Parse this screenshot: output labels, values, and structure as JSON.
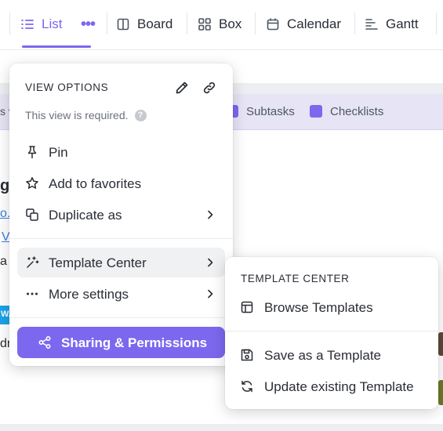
{
  "tabs": [
    {
      "label": "List",
      "icon": "list-icon",
      "active": true
    },
    {
      "label": "Board",
      "icon": "board-icon"
    },
    {
      "label": "Box",
      "icon": "box-grid-icon"
    },
    {
      "label": "Calendar",
      "icon": "calendar-icon"
    },
    {
      "label": "Gantt",
      "icon": "gantt-icon"
    }
  ],
  "list_more_label": "•••",
  "background": {
    "checklist_items": [
      "Subtasks",
      "Checklists"
    ],
    "left_fragments": [
      "s v",
      "g",
      "o.c",
      "V",
      "a",
      "WA",
      "dr"
    ]
  },
  "view_options": {
    "title": "VIEW OPTIONS",
    "subtitle": "This view is required.",
    "help_icon_label": "?",
    "items": [
      {
        "label": "Pin",
        "icon": "pin-icon"
      },
      {
        "label": "Add to favorites",
        "icon": "star-icon"
      },
      {
        "label": "Duplicate as",
        "icon": "duplicate-icon",
        "submenu": true
      },
      {
        "label": "Template Center",
        "icon": "magic-wand-icon",
        "submenu": true,
        "active": true
      },
      {
        "label": "More settings",
        "icon": "more-dots-icon",
        "submenu": true
      }
    ],
    "share_button": "Sharing & Permissions"
  },
  "template_center": {
    "title": "TEMPLATE CENTER",
    "items": [
      {
        "label": "Browse Templates",
        "icon": "template-layout-icon"
      },
      {
        "label": "Save as a Template",
        "icon": "save-icon"
      },
      {
        "label": "Update existing Template",
        "icon": "refresh-icon"
      }
    ]
  },
  "colors": {
    "accent": "#7b68ee",
    "text": "#292d34",
    "muted": "#6b7079",
    "hover": "#f0f1f3"
  }
}
